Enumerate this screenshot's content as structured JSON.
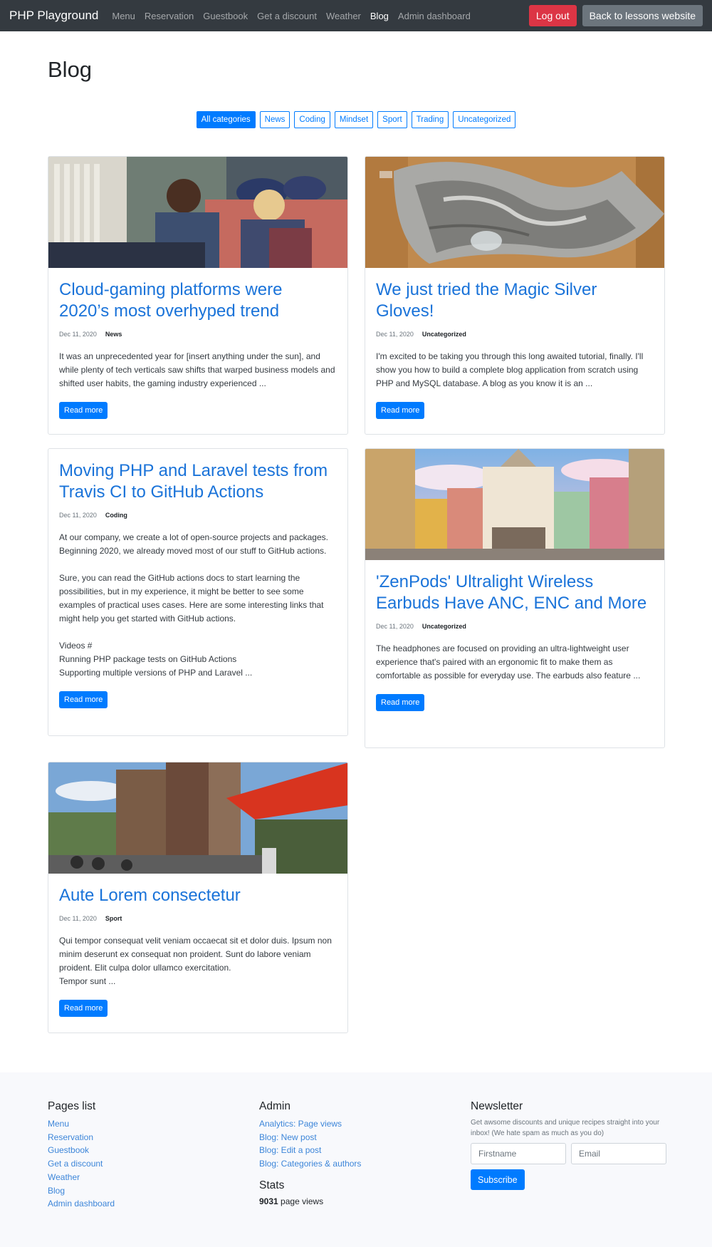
{
  "navbar": {
    "brand": "PHP Playground",
    "links": [
      "Menu",
      "Reservation",
      "Guestbook",
      "Get a discount",
      "Weather",
      "Blog",
      "Admin dashboard"
    ],
    "active": "Blog",
    "logout_label": "Log out",
    "back_label": "Back to lessons website",
    "colors": {
      "navbar_bg": "#343a40",
      "logout_bg": "#dc3545",
      "back_bg": "#6c757d"
    }
  },
  "page": {
    "title": "Blog"
  },
  "filters": {
    "items": [
      "All categories",
      "News",
      "Coding",
      "Mindset",
      "Sport",
      "Trading",
      "Uncategorized"
    ],
    "active": "All categories",
    "accent": "#007bff"
  },
  "posts": [
    {
      "title": "Cloud-gaming platforms were 2020’s most overhyped trend",
      "date": "Dec 11, 2020",
      "category": "News",
      "excerpt": "It was an unprecedented year for [insert anything under the sun], and while plenty of tech verticals saw shifts that warped business models and shifted user habits, the gaming industry experienced ...",
      "read_more": "Read more",
      "image": "two-people-playing-video-games-photo"
    },
    {
      "title": "We just tried the Magic Silver Gloves!",
      "date": "Dec 11, 2020",
      "category": "Uncategorized",
      "excerpt": "I'm excited to be taking you through this long awaited tutorial, finally. I'll show you how to build a complete blog application from scratch using PHP and MySQL database. A blog as you know it is an ...",
      "read_more": "Read more",
      "image": "knitted-silver-gloves-photo"
    },
    {
      "title": "Moving PHP and Laravel tests from Travis CI to GitHub Actions",
      "date": "Dec 11, 2020",
      "category": "Coding",
      "excerpt": "At our company, we create a lot of open-source projects and packages. Beginning 2020, we already moved most of our stuff to GitHub actions.\n\nSure, you can read the GitHub actions docs to start learning the possibilities, but in my experience, it might be better to see some examples of practical uses cases. Here are some interesting links that might help you get started with GitHub actions.\n\nVideos #\nRunning PHP package tests on GitHub Actions\nSupporting multiple versions of PHP and Laravel ...",
      "read_more": "Read more",
      "image": ""
    },
    {
      "title": "'ZenPods' Ultralight Wireless Earbuds Have ANC, ENC and More",
      "date": "Dec 11, 2020",
      "category": "Uncategorized",
      "excerpt": "The headphones are focused on providing an ultra-lightweight user experience that's paired with an ergonomic fit to make them as comfortable as possible for everyday use. The earbuds also feature ...",
      "read_more": "Read more",
      "image": "colorful-city-street-photo"
    },
    {
      "title": "Aute Lorem consectetur",
      "date": "Dec 11, 2020",
      "category": "Sport",
      "excerpt": "Qui tempor consequat velit veniam occaecat sit et dolor duis. Ipsum non minim deserunt ex consequat non proident. Sunt do labore veniam proident. Elit culpa dolor ullamco exercitation.\nTempor sunt ...",
      "read_more": "Read more",
      "image": "canal-street-with-red-awning-photo"
    }
  ],
  "footer": {
    "pages_title": "Pages list",
    "pages": [
      "Menu",
      "Reservation",
      "Guestbook",
      "Get a discount",
      "Weather",
      "Blog",
      "Admin dashboard"
    ],
    "admin_title": "Admin",
    "admin_links": [
      "Analytics: Page views",
      "Blog: New post",
      "Blog: Edit a post",
      "Blog: Categories & authors"
    ],
    "stats_title": "Stats",
    "page_views_value": "9031",
    "page_views_label": "page views",
    "newsletter_title": "Newsletter",
    "newsletter_text": "Get awsome discounts and unique recipes straight into your inbox! (We hate spam as much as you do)",
    "firstname_placeholder": "Firstname",
    "email_placeholder": "Email",
    "subscribe_label": "Subscribe"
  }
}
